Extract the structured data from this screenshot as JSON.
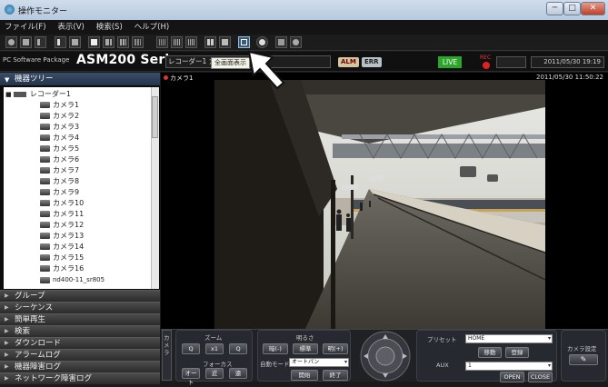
{
  "window": {
    "title": "操作モニター",
    "minimize": "─",
    "maximize": "□",
    "close": "✕"
  },
  "menu": [
    "ファイル(F)",
    "表示(V)",
    "検索(S)",
    "ヘルプ(H)"
  ],
  "toolbar_icons": [
    "camera-icon",
    "layout-1-icon",
    "layout-4-icon",
    "layout-9-icon",
    "layout-16-icon",
    "fullscreen-icon",
    "sequence-icon",
    "snapshot-icon"
  ],
  "header": {
    "package": "PC Software Package",
    "series": "ASM200 Series",
    "camera_field": "レコーダー1 カメラ",
    "tooltip": "全画面表示",
    "alm": "ALM",
    "err": "ERR",
    "live": "LIVE",
    "rec": "REC",
    "datetime": "2011/05/30 19:19"
  },
  "tree": {
    "title": "機器ツリー",
    "recorder": "レコーダー1",
    "cameras": [
      "カメラ1",
      "カメラ2",
      "カメラ3",
      "カメラ4",
      "カメラ5",
      "カメラ6",
      "カメラ7",
      "カメラ8",
      "カメラ9",
      "カメラ10",
      "カメラ11",
      "カメラ12",
      "カメラ13",
      "カメラ14",
      "カメラ15",
      "カメラ16",
      "nd400-11_sr805"
    ]
  },
  "side_menu": [
    "グループ",
    "シーケンス",
    "簡単再生",
    "検索",
    "ダウンロード",
    "アラームログ",
    "機器障害ログ",
    "ネットワーク障害ログ"
  ],
  "video": {
    "camera_label": "カメラ1",
    "timestamp": "2011/05/30 11:50:22"
  },
  "controls": {
    "camera_tab": "カメラ",
    "zoom": "ズーム",
    "zoom_out": "Q",
    "zoom_x1": "x1",
    "zoom_in": "Q",
    "focus": "フォーカス",
    "focus_auto": "オート",
    "focus_near": "近",
    "focus_far": "遠",
    "brightness": "明るさ",
    "bright_minus": "暗(-)",
    "bright_std": "標準",
    "bright_plus": "明(+)",
    "auto_mode": "自動モード",
    "auto_mode_value": "オートパン",
    "start": "開始",
    "end": "終了",
    "preset": "プリセット",
    "preset_value": "HOME",
    "move": "移動",
    "register": "登録",
    "aux": "AUX",
    "aux_value": "1",
    "open": "OPEN",
    "close": "CLOSE",
    "camera_settings": "カメラ設定"
  }
}
